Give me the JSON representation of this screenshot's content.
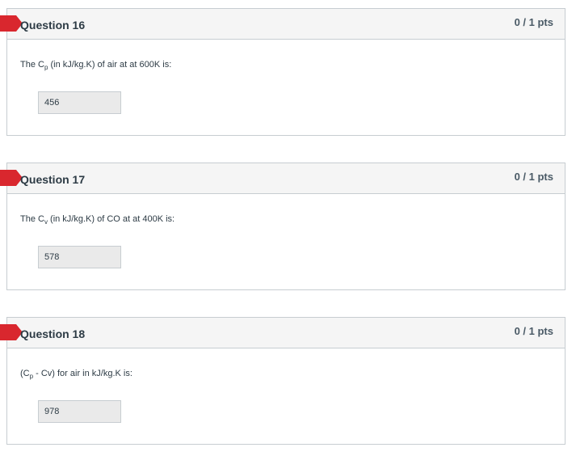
{
  "questions": [
    {
      "title": "Question 16",
      "points": "0 / 1 pts",
      "text_pre": "The C",
      "text_sub": "p",
      "text_post": " (in kJ/kg.K) of air at at 600K is:",
      "answer": "456"
    },
    {
      "title": "Question 17",
      "points": "0 / 1 pts",
      "text_pre": "The C",
      "text_sub": "v",
      "text_post": " (in kJ/kg.K) of CO at at 400K is:",
      "answer": "578"
    },
    {
      "title": "Question 18",
      "points": "0 / 1 pts",
      "text_pre": "(C",
      "text_sub": "p",
      "text_post": " - Cv) for air in kJ/kg.K is:",
      "answer": "978"
    }
  ],
  "colors": {
    "flag": "#d9272e",
    "header_bg": "#f5f5f5",
    "border": "#c7cdd1",
    "answer_bg": "#eaeaea"
  },
  "icons": {
    "flag": "incorrect-flag-icon"
  }
}
